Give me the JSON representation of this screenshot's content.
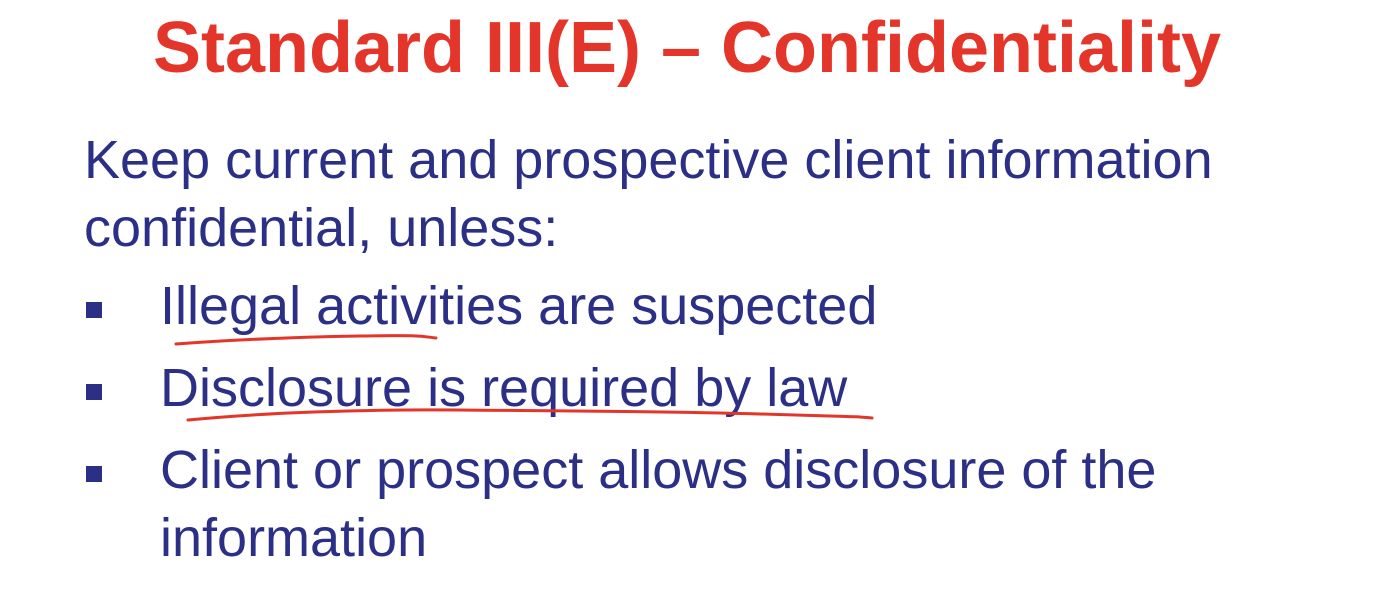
{
  "slide": {
    "title": "Standard III(E) – Confidentiality",
    "intro": "Keep current and prospective client information confidential, unless:",
    "bullets": [
      "Illegal activities are suspected",
      "Disclosure is required by law",
      "Client or prospect allows disclosure of the information"
    ]
  },
  "colors": {
    "title": "#e4352a",
    "body": "#2b2f86",
    "annotation": "#e4352a"
  }
}
